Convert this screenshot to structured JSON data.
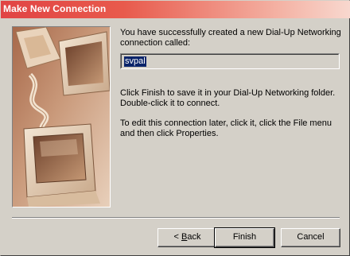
{
  "window": {
    "title": "Make New Connection"
  },
  "content": {
    "intro_text": "You have successfully created a new Dial-Up Networking connection called:",
    "connection_name": "svpal",
    "finish_text": "Click Finish to save it in your Dial-Up Networking folder. Double-click it to connect.",
    "edit_text": "To edit this connection later, click it, click the File menu and then click Properties."
  },
  "buttons": {
    "back_underlined": "B",
    "back_rest": "ack",
    "back_prefix": "< ",
    "finish": "Finish",
    "cancel": "Cancel"
  },
  "colors": {
    "title_gradient_start": "#e14444",
    "title_gradient_end": "#f8d8cf",
    "selection": "#0a246a",
    "face": "#d4d0c8"
  },
  "icons": {
    "illustration": "computer-monitors-illustration"
  }
}
